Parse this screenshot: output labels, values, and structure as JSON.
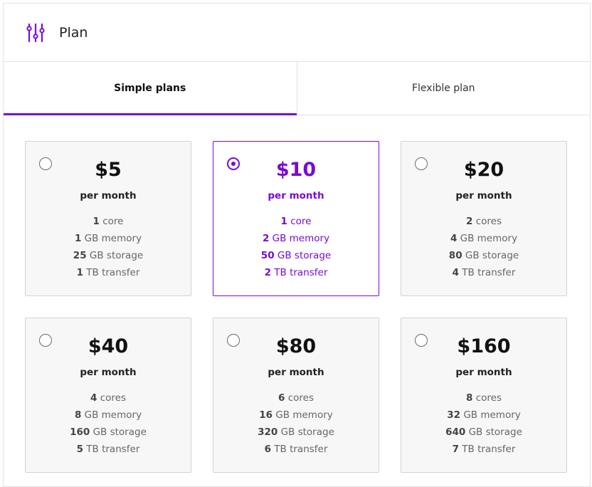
{
  "header": {
    "title": "Plan",
    "icon": "sliders-icon"
  },
  "tabs": [
    {
      "label": "Simple plans",
      "active": true
    },
    {
      "label": "Flexible plan",
      "active": false
    }
  ],
  "accent_color": "#7a0bd1",
  "plans": [
    {
      "price": "$5",
      "period": "per month",
      "selected": false,
      "cores": "1",
      "cores_unit": "core",
      "memory": "1",
      "memory_unit": "GB memory",
      "storage": "25",
      "storage_unit": "GB storage",
      "transfer": "1",
      "transfer_unit": "TB transfer"
    },
    {
      "price": "$10",
      "period": "per month",
      "selected": true,
      "cores": "1",
      "cores_unit": "core",
      "memory": "2",
      "memory_unit": "GB memory",
      "storage": "50",
      "storage_unit": "GB storage",
      "transfer": "2",
      "transfer_unit": "TB transfer"
    },
    {
      "price": "$20",
      "period": "per month",
      "selected": false,
      "cores": "2",
      "cores_unit": "cores",
      "memory": "4",
      "memory_unit": "GB memory",
      "storage": "80",
      "storage_unit": "GB storage",
      "transfer": "4",
      "transfer_unit": "TB transfer"
    },
    {
      "price": "$40",
      "period": "per month",
      "selected": false,
      "cores": "4",
      "cores_unit": "cores",
      "memory": "8",
      "memory_unit": "GB memory",
      "storage": "160",
      "storage_unit": "GB storage",
      "transfer": "5",
      "transfer_unit": "TB transfer"
    },
    {
      "price": "$80",
      "period": "per month",
      "selected": false,
      "cores": "6",
      "cores_unit": "cores",
      "memory": "16",
      "memory_unit": "GB memory",
      "storage": "320",
      "storage_unit": "GB storage",
      "transfer": "6",
      "transfer_unit": "TB transfer"
    },
    {
      "price": "$160",
      "period": "per month",
      "selected": false,
      "cores": "8",
      "cores_unit": "cores",
      "memory": "32",
      "memory_unit": "GB memory",
      "storage": "640",
      "storage_unit": "GB storage",
      "transfer": "7",
      "transfer_unit": "TB transfer"
    }
  ]
}
